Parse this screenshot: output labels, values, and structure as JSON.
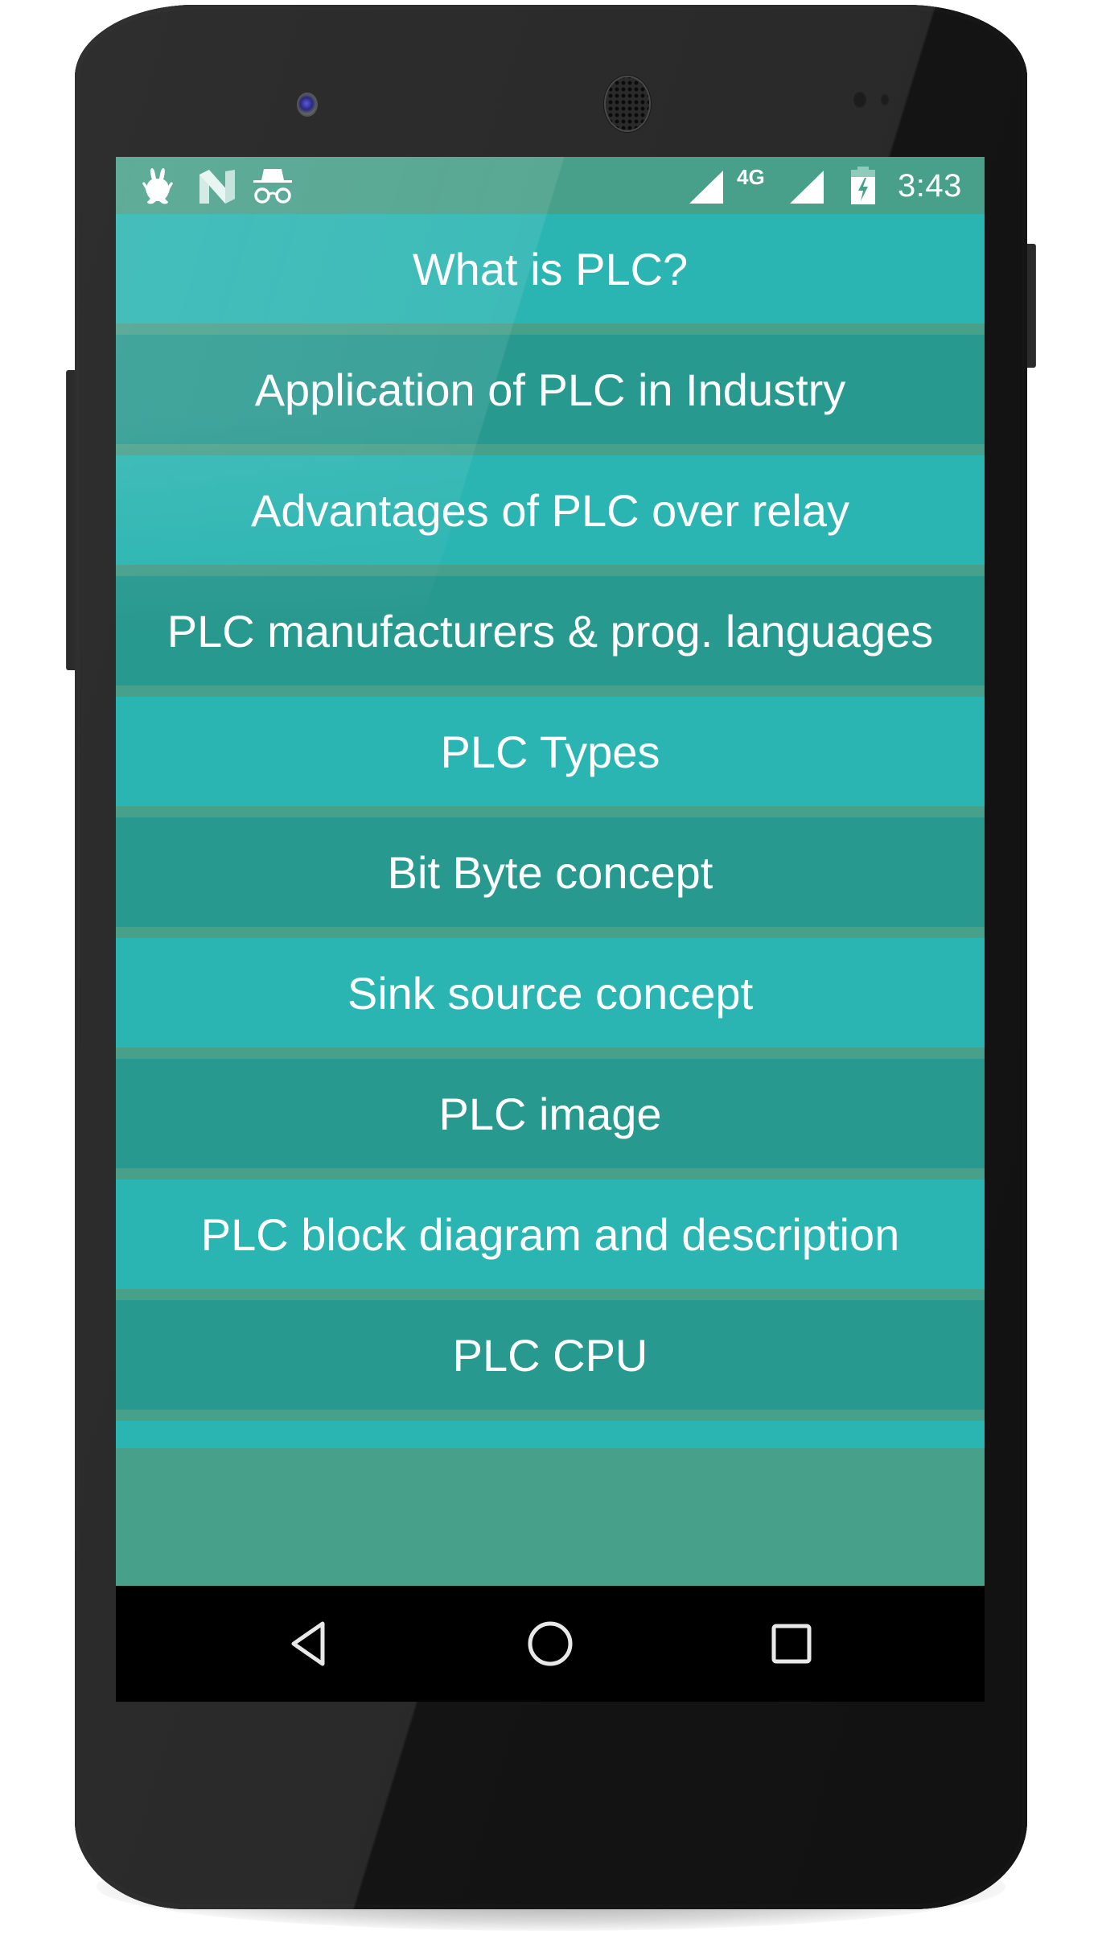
{
  "device": {
    "model": "android-phone"
  },
  "status_bar": {
    "left_icons": [
      "bunny-icon",
      "n-logo-icon",
      "incognito-icon"
    ],
    "network_label": "4G",
    "right_icons": [
      "signal-icon",
      "signal-icon",
      "battery-charging-icon"
    ],
    "time": "3:43"
  },
  "menu": {
    "items": [
      {
        "label": "What is PLC?",
        "shade": "light"
      },
      {
        "label": "Application of PLC in Industry",
        "shade": "dark"
      },
      {
        "label": "Advantages of PLC over relay",
        "shade": "light"
      },
      {
        "label": "PLC manufacturers & prog. languages",
        "shade": "dark"
      },
      {
        "label": "PLC Types",
        "shade": "light"
      },
      {
        "label": "Bit Byte concept",
        "shade": "dark"
      },
      {
        "label": "Sink source concept",
        "shade": "light"
      },
      {
        "label": "PLC image",
        "shade": "dark"
      },
      {
        "label": "PLC block diagram and description",
        "shade": "light"
      },
      {
        "label": "PLC CPU",
        "shade": "dark"
      }
    ]
  },
  "nav_bar": {
    "buttons": [
      {
        "name": "back",
        "icon": "back-triangle-icon"
      },
      {
        "name": "home",
        "icon": "home-circle-icon"
      },
      {
        "name": "recents",
        "icon": "recents-square-icon"
      }
    ]
  },
  "colors": {
    "status_bar": "#48a08a",
    "item_light": "#2bb5b2",
    "item_dark": "#28998f",
    "divider": "#46a08a",
    "text": "#ffffff",
    "nav_bar": "#000000"
  }
}
